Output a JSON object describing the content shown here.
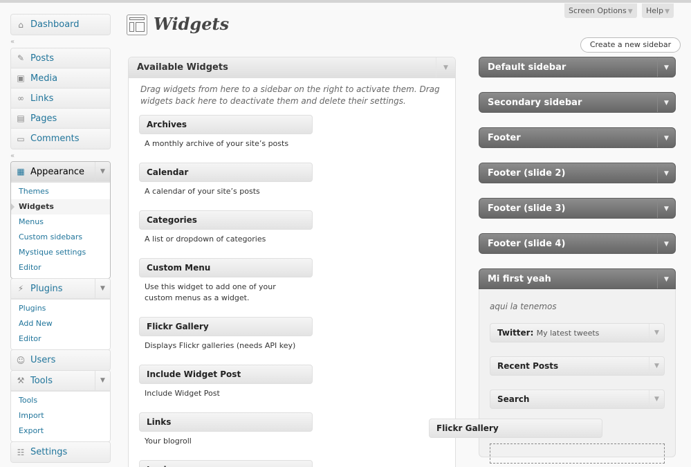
{
  "menu": {
    "dashboard": "Dashboard",
    "posts": "Posts",
    "media": "Media",
    "links": "Links",
    "pages": "Pages",
    "comments": "Comments",
    "appearance": "Appearance",
    "appearance_sub": [
      "Themes",
      "Widgets",
      "Menus",
      "Custom sidebars",
      "Mystique settings",
      "Editor"
    ],
    "plugins": "Plugins",
    "plugins_sub": [
      "Plugins",
      "Add New",
      "Editor"
    ],
    "users": "Users",
    "tools": "Tools",
    "tools_sub": [
      "Tools",
      "Import",
      "Export"
    ],
    "settings": "Settings"
  },
  "header": {
    "title": "Widgets",
    "screen_options": "Screen Options",
    "help": "Help",
    "create_sidebar": "Create a new sidebar"
  },
  "available": {
    "title": "Available Widgets",
    "description": "Drag widgets from here to a sidebar on the right to activate them. Drag widgets back here to deactivate them and delete their settings.",
    "widgets": [
      {
        "name": "Archives",
        "desc": "A monthly archive of your site’s posts"
      },
      {
        "name": "Calendar",
        "desc": "A calendar of your site’s posts"
      },
      {
        "name": "Categories",
        "desc": "A list or dropdown of categories"
      },
      {
        "name": "Custom Menu",
        "desc": "Use this widget to add one of your custom menus as a widget."
      },
      {
        "name": "Flickr Gallery",
        "desc": "Displays Flickr galleries (needs API key)"
      },
      {
        "name": "Include Widget Post",
        "desc": "Include Widget Post"
      },
      {
        "name": "Links",
        "desc": "Your blogroll"
      },
      {
        "name": "Login",
        "desc": ""
      }
    ]
  },
  "sidebars": [
    {
      "name": "Default sidebar"
    },
    {
      "name": "Secondary sidebar"
    },
    {
      "name": "Footer"
    },
    {
      "name": "Footer (slide 2)"
    },
    {
      "name": "Footer (slide 3)"
    },
    {
      "name": "Footer (slide 4)"
    },
    {
      "name": "Mi first yeah"
    }
  ],
  "open_sidebar": {
    "description": "aqui la tenemos",
    "widgets": [
      {
        "name": "Twitter",
        "sub": "My latest tweets"
      },
      {
        "name": "Recent Posts",
        "sub": ""
      },
      {
        "name": "Search",
        "sub": ""
      }
    ]
  },
  "dragging_widget": "Flickr Gallery"
}
